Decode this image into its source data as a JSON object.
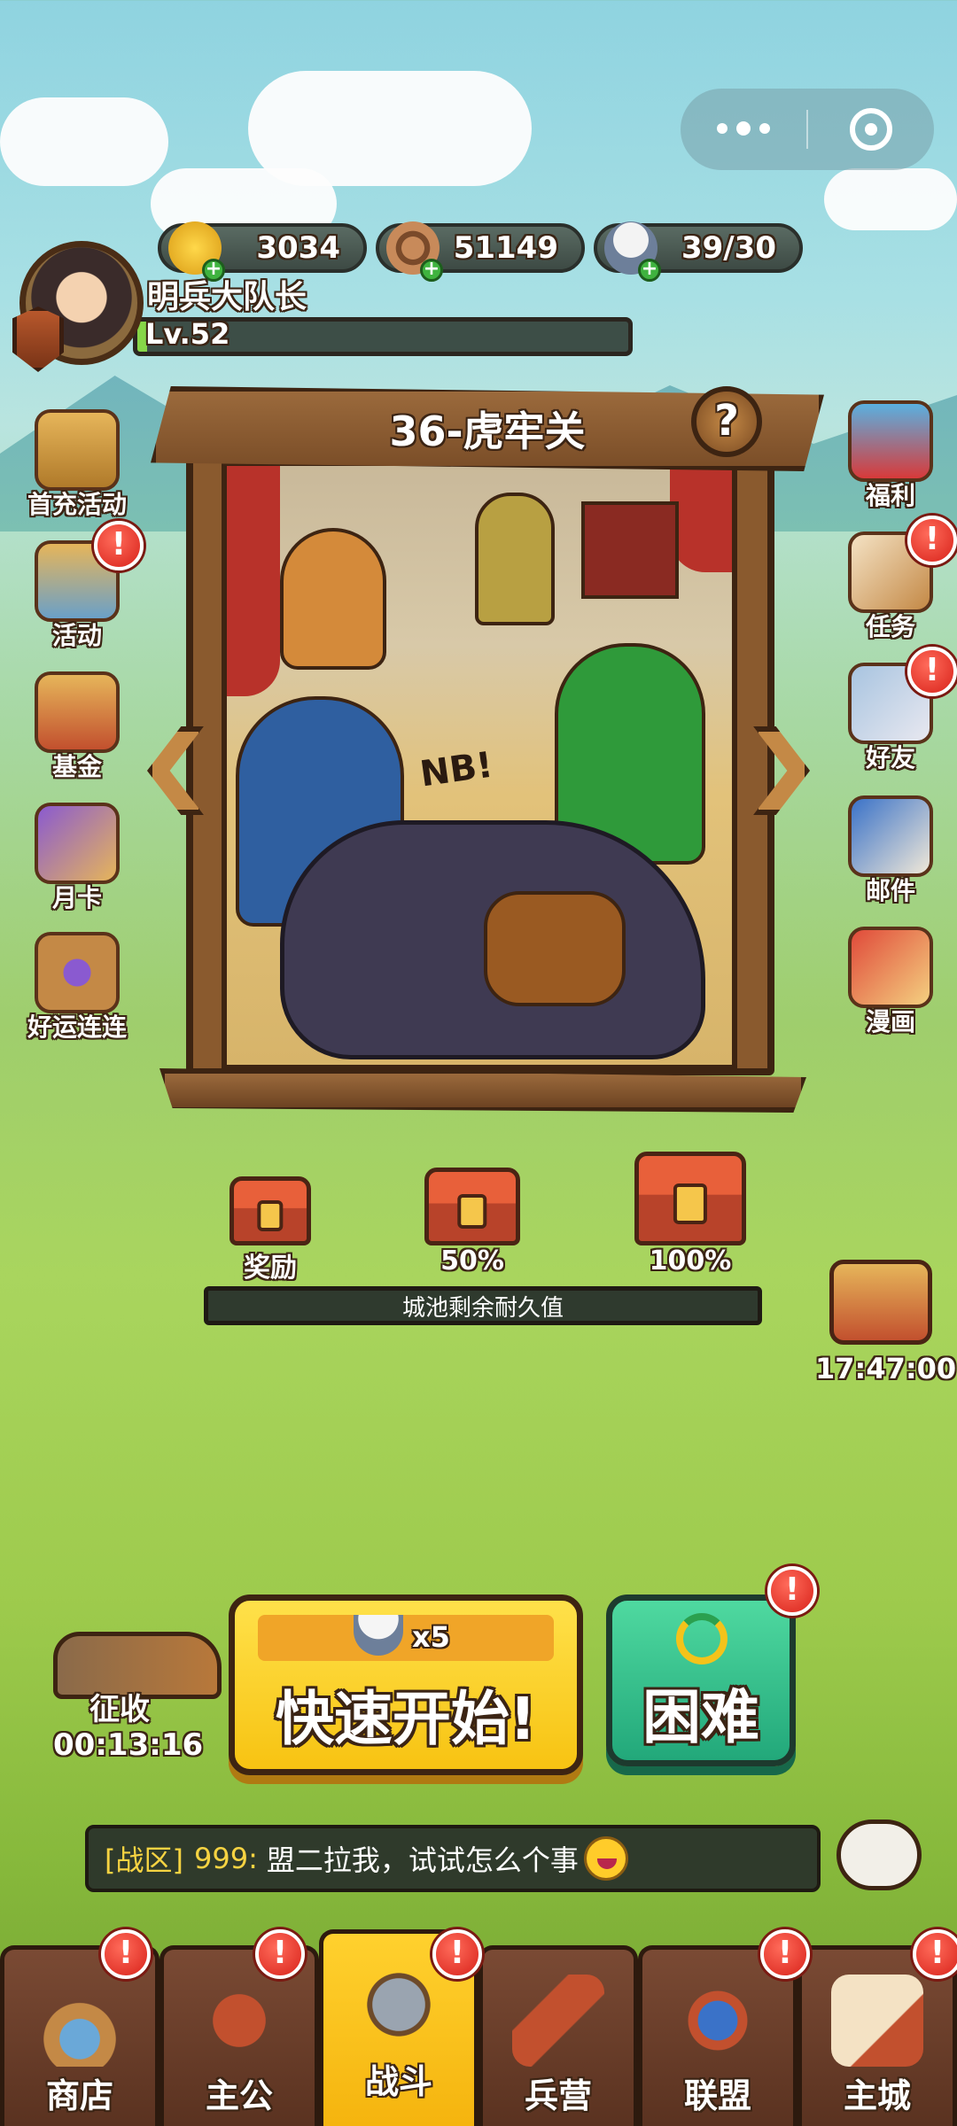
{
  "capsule": {
    "menu_icon": "more-dots-icon",
    "close_icon": "target-circle-icon"
  },
  "resources": [
    {
      "icon": "gold-ingot-icon",
      "value": "3034"
    },
    {
      "icon": "copper-coin-icon",
      "value": "51149"
    },
    {
      "icon": "rice-bowl-icon",
      "value": "39/30"
    }
  ],
  "player": {
    "name": "明兵大队长",
    "level": "Lv.52",
    "xp_fraction": 0.02
  },
  "left_menu": [
    {
      "label": "首充活动",
      "icon": "gift-bag-icon",
      "alert": false
    },
    {
      "label": "活动",
      "icon": "event-bag-icon",
      "alert": true
    },
    {
      "label": "基金",
      "icon": "treasure-box-icon",
      "alert": false
    },
    {
      "label": "月卡",
      "icon": "monthly-card-icon",
      "alert": false
    },
    {
      "label": "好运连连",
      "icon": "lucky-frame-icon",
      "alert": false
    }
  ],
  "right_menu": [
    {
      "label": "福利",
      "icon": "welfare-box-icon",
      "alert": false
    },
    {
      "label": "任务",
      "icon": "quest-scroll-icon",
      "alert": true
    },
    {
      "label": "好友",
      "icon": "friends-handshake-icon",
      "alert": true
    },
    {
      "label": "邮件",
      "icon": "mail-icon",
      "alert": false
    },
    {
      "label": "漫画",
      "icon": "comic-book-icon",
      "alert": false
    }
  ],
  "stage": {
    "title": "36-虎牢关",
    "help": "?",
    "art_caption": "NB!"
  },
  "chests": [
    {
      "label": "奖励"
    },
    {
      "label": "50%"
    },
    {
      "label": "100%"
    }
  ],
  "durability_label": "城池剩余耐久值",
  "timer": "17:47:00",
  "collect": {
    "label": "征收",
    "time": "00:13:16"
  },
  "quick_start": {
    "cost": "x5",
    "label": "快速开始!"
  },
  "hard": {
    "label": "困难"
  },
  "chat": {
    "channel": "[战区]",
    "sender": "999:",
    "message": "盟二拉我，试试怎么个事"
  },
  "nav": [
    {
      "label": "商店",
      "icon": "shop-scale-icon",
      "alert": true,
      "active": false
    },
    {
      "label": "主公",
      "icon": "lord-helmet-icon",
      "alert": true,
      "active": false
    },
    {
      "label": "战斗",
      "icon": "crossed-swords-icon",
      "alert": true,
      "active": true
    },
    {
      "label": "兵营",
      "icon": "barracks-flag-icon",
      "alert": false,
      "active": false
    },
    {
      "label": "联盟",
      "icon": "alliance-banner-icon",
      "alert": true,
      "active": false
    },
    {
      "label": "主城",
      "icon": "city-map-icon",
      "alert": true,
      "active": false
    }
  ],
  "colors": {
    "accent_yellow": "#f7c312",
    "hard_green": "#22a87a",
    "frame_brown": "#7b4e28",
    "alert_red": "#d8221a"
  }
}
